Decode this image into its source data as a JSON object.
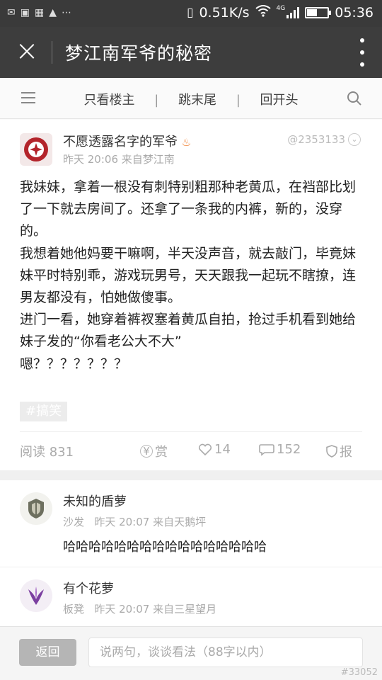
{
  "status_bar": {
    "speed": "0.51K/s",
    "signal": "4G",
    "time": "05:36",
    "battery_level": 0.5
  },
  "title_bar": {
    "title": "梦江南军爷的秘密"
  },
  "toolbar": {
    "links": [
      "只看楼主",
      "跳末尾",
      "回开头"
    ],
    "separator": "|"
  },
  "post": {
    "author": "不愿透露名字的军爷",
    "meta": "昨天 20:06  来自梦江南",
    "uid": "@2353133",
    "content_lines": [
      "我妹妹，拿着一根没有刺特别粗那种老黄瓜，在裆部比划了一下就去房间了。还拿了一条我的内裤，新的，没穿的。",
      "我想着她他妈要干嘛啊，半天没声音，就去敲门，毕竟妹妹平时特别乖，游戏玩男号，天天跟我一起玩不瞎撩，连男友都没有，怕她做傻事。",
      "进门一看，她穿着裤衩塞着黄瓜自拍，抢过手机看到她给妹子发的“你看老公大不大”",
      "嗯？？？？？？？"
    ],
    "tag": "#搞笑",
    "reads": "阅读 831",
    "reward": "赏",
    "likes": "14",
    "comments": "152",
    "report": "报"
  },
  "comments": [
    {
      "name": "未知的盾萝",
      "floor": "沙发",
      "meta": "昨天 20:07  来自天鹅坪",
      "text": "哈哈哈哈哈哈哈哈哈哈哈哈哈哈哈哈"
    },
    {
      "name": "有个花萝",
      "floor": "板凳",
      "meta": "昨天 20:07  来自三星望月",
      "text": ""
    }
  ],
  "bottom_bar": {
    "back_label": "返回",
    "input_placeholder": "说两句，谈谈看法（88字以内）"
  },
  "watermark": "#33052",
  "colors": {
    "header_bg": "#3d3d3d",
    "status_bg": "#3a3a3a",
    "avatar_red": "#b3242b",
    "fire": "#f07b2a"
  }
}
